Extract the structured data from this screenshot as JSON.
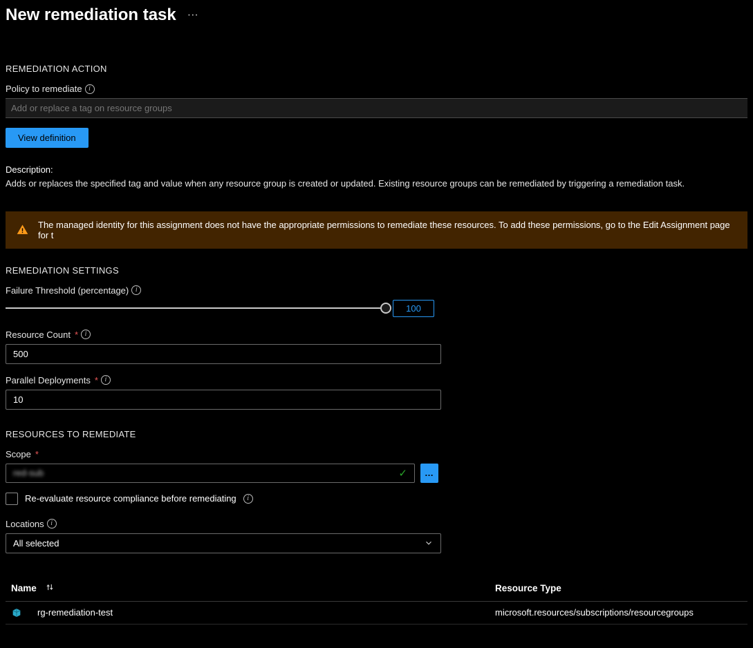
{
  "header": {
    "title": "New remediation task"
  },
  "action_section": {
    "heading": "REMEDIATION ACTION",
    "policy_label": "Policy to remediate",
    "policy_placeholder": "Add or replace a tag on resource groups",
    "view_definition_btn": "View definition",
    "description_label": "Description:",
    "description_text": "Adds or replaces the specified tag and value when any resource group is created or updated. Existing resource groups can be remediated by triggering a remediation task."
  },
  "warning": {
    "text": "The managed identity for this assignment does not have the appropriate permissions to remediate these resources. To add these permissions, go to the Edit Assignment page for t"
  },
  "settings_section": {
    "heading": "REMEDIATION SETTINGS",
    "failure_threshold_label": "Failure Threshold (percentage)",
    "failure_threshold_value": "100",
    "failure_threshold_pct": 100,
    "resource_count_label": "Resource Count",
    "resource_count_value": "500",
    "parallel_deployments_label": "Parallel Deployments",
    "parallel_deployments_value": "10"
  },
  "resources_section": {
    "heading": "RESOURCES TO REMEDIATE",
    "scope_label": "Scope",
    "scope_value": "red-sub",
    "reevaluate_label": "Re-evaluate resource compliance before remediating",
    "locations_label": "Locations",
    "locations_value": "All selected",
    "table": {
      "headers": {
        "name": "Name",
        "type": "Resource Type"
      },
      "rows": [
        {
          "name": "rg-remediation-test",
          "type": "microsoft.resources/subscriptions/resourcegroups"
        }
      ]
    }
  }
}
